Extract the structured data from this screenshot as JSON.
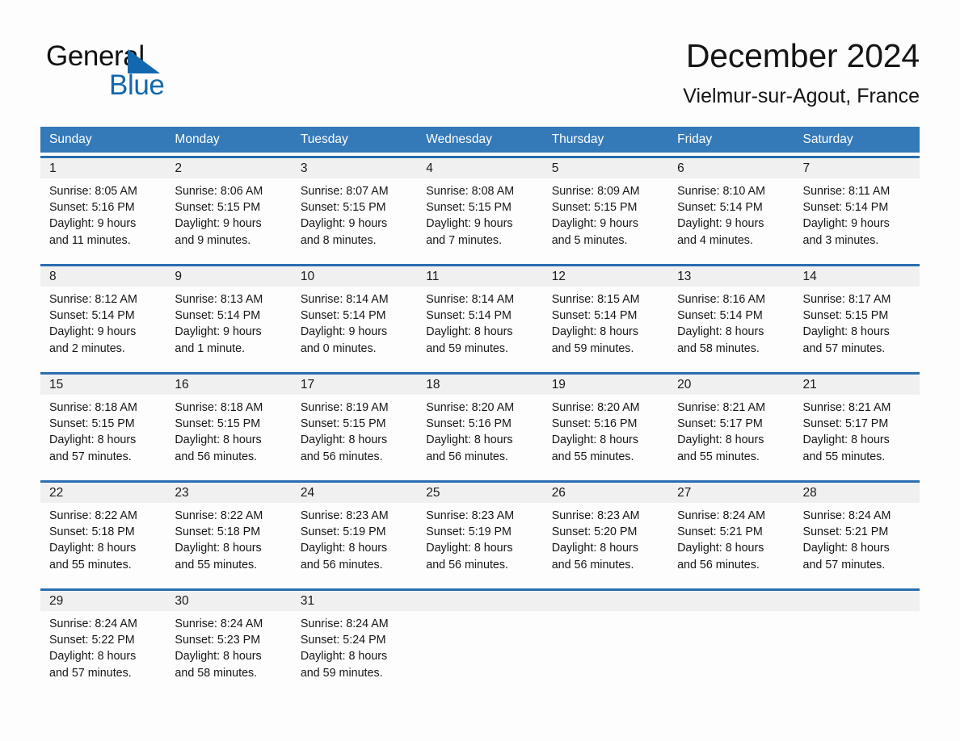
{
  "brand": {
    "word_general": "General",
    "word_blue": "Blue",
    "triangle_color": "#1368ad"
  },
  "header": {
    "title": "December 2024",
    "subtitle": "Vielmur-sur-Agout, France"
  },
  "theme": {
    "header_blue": "#3479b8",
    "rule_blue": "#2a6db0",
    "daynum_band": "#f0f0f0",
    "page_background": "#fdfdfd",
    "text": "#1a1a1a"
  },
  "weekdays": [
    "Sunday",
    "Monday",
    "Tuesday",
    "Wednesday",
    "Thursday",
    "Friday",
    "Saturday"
  ],
  "weeks": [
    {
      "days": [
        {
          "number": "1",
          "lines": [
            "Sunrise: 8:05 AM",
            "Sunset: 5:16 PM",
            "Daylight: 9 hours",
            "and 11 minutes."
          ]
        },
        {
          "number": "2",
          "lines": [
            "Sunrise: 8:06 AM",
            "Sunset: 5:15 PM",
            "Daylight: 9 hours",
            "and 9 minutes."
          ]
        },
        {
          "number": "3",
          "lines": [
            "Sunrise: 8:07 AM",
            "Sunset: 5:15 PM",
            "Daylight: 9 hours",
            "and 8 minutes."
          ]
        },
        {
          "number": "4",
          "lines": [
            "Sunrise: 8:08 AM",
            "Sunset: 5:15 PM",
            "Daylight: 9 hours",
            "and 7 minutes."
          ]
        },
        {
          "number": "5",
          "lines": [
            "Sunrise: 8:09 AM",
            "Sunset: 5:15 PM",
            "Daylight: 9 hours",
            "and 5 minutes."
          ]
        },
        {
          "number": "6",
          "lines": [
            "Sunrise: 8:10 AM",
            "Sunset: 5:14 PM",
            "Daylight: 9 hours",
            "and 4 minutes."
          ]
        },
        {
          "number": "7",
          "lines": [
            "Sunrise: 8:11 AM",
            "Sunset: 5:14 PM",
            "Daylight: 9 hours",
            "and 3 minutes."
          ]
        }
      ]
    },
    {
      "days": [
        {
          "number": "8",
          "lines": [
            "Sunrise: 8:12 AM",
            "Sunset: 5:14 PM",
            "Daylight: 9 hours",
            "and 2 minutes."
          ]
        },
        {
          "number": "9",
          "lines": [
            "Sunrise: 8:13 AM",
            "Sunset: 5:14 PM",
            "Daylight: 9 hours",
            "and 1 minute."
          ]
        },
        {
          "number": "10",
          "lines": [
            "Sunrise: 8:14 AM",
            "Sunset: 5:14 PM",
            "Daylight: 9 hours",
            "and 0 minutes."
          ]
        },
        {
          "number": "11",
          "lines": [
            "Sunrise: 8:14 AM",
            "Sunset: 5:14 PM",
            "Daylight: 8 hours",
            "and 59 minutes."
          ]
        },
        {
          "number": "12",
          "lines": [
            "Sunrise: 8:15 AM",
            "Sunset: 5:14 PM",
            "Daylight: 8 hours",
            "and 59 minutes."
          ]
        },
        {
          "number": "13",
          "lines": [
            "Sunrise: 8:16 AM",
            "Sunset: 5:14 PM",
            "Daylight: 8 hours",
            "and 58 minutes."
          ]
        },
        {
          "number": "14",
          "lines": [
            "Sunrise: 8:17 AM",
            "Sunset: 5:15 PM",
            "Daylight: 8 hours",
            "and 57 minutes."
          ]
        }
      ]
    },
    {
      "days": [
        {
          "number": "15",
          "lines": [
            "Sunrise: 8:18 AM",
            "Sunset: 5:15 PM",
            "Daylight: 8 hours",
            "and 57 minutes."
          ]
        },
        {
          "number": "16",
          "lines": [
            "Sunrise: 8:18 AM",
            "Sunset: 5:15 PM",
            "Daylight: 8 hours",
            "and 56 minutes."
          ]
        },
        {
          "number": "17",
          "lines": [
            "Sunrise: 8:19 AM",
            "Sunset: 5:15 PM",
            "Daylight: 8 hours",
            "and 56 minutes."
          ]
        },
        {
          "number": "18",
          "lines": [
            "Sunrise: 8:20 AM",
            "Sunset: 5:16 PM",
            "Daylight: 8 hours",
            "and 56 minutes."
          ]
        },
        {
          "number": "19",
          "lines": [
            "Sunrise: 8:20 AM",
            "Sunset: 5:16 PM",
            "Daylight: 8 hours",
            "and 55 minutes."
          ]
        },
        {
          "number": "20",
          "lines": [
            "Sunrise: 8:21 AM",
            "Sunset: 5:17 PM",
            "Daylight: 8 hours",
            "and 55 minutes."
          ]
        },
        {
          "number": "21",
          "lines": [
            "Sunrise: 8:21 AM",
            "Sunset: 5:17 PM",
            "Daylight: 8 hours",
            "and 55 minutes."
          ]
        }
      ]
    },
    {
      "days": [
        {
          "number": "22",
          "lines": [
            "Sunrise: 8:22 AM",
            "Sunset: 5:18 PM",
            "Daylight: 8 hours",
            "and 55 minutes."
          ]
        },
        {
          "number": "23",
          "lines": [
            "Sunrise: 8:22 AM",
            "Sunset: 5:18 PM",
            "Daylight: 8 hours",
            "and 55 minutes."
          ]
        },
        {
          "number": "24",
          "lines": [
            "Sunrise: 8:23 AM",
            "Sunset: 5:19 PM",
            "Daylight: 8 hours",
            "and 56 minutes."
          ]
        },
        {
          "number": "25",
          "lines": [
            "Sunrise: 8:23 AM",
            "Sunset: 5:19 PM",
            "Daylight: 8 hours",
            "and 56 minutes."
          ]
        },
        {
          "number": "26",
          "lines": [
            "Sunrise: 8:23 AM",
            "Sunset: 5:20 PM",
            "Daylight: 8 hours",
            "and 56 minutes."
          ]
        },
        {
          "number": "27",
          "lines": [
            "Sunrise: 8:24 AM",
            "Sunset: 5:21 PM",
            "Daylight: 8 hours",
            "and 56 minutes."
          ]
        },
        {
          "number": "28",
          "lines": [
            "Sunrise: 8:24 AM",
            "Sunset: 5:21 PM",
            "Daylight: 8 hours",
            "and 57 minutes."
          ]
        }
      ]
    },
    {
      "days": [
        {
          "number": "29",
          "lines": [
            "Sunrise: 8:24 AM",
            "Sunset: 5:22 PM",
            "Daylight: 8 hours",
            "and 57 minutes."
          ]
        },
        {
          "number": "30",
          "lines": [
            "Sunrise: 8:24 AM",
            "Sunset: 5:23 PM",
            "Daylight: 8 hours",
            "and 58 minutes."
          ]
        },
        {
          "number": "31",
          "lines": [
            "Sunrise: 8:24 AM",
            "Sunset: 5:24 PM",
            "Daylight: 8 hours",
            "and 59 minutes."
          ]
        },
        {
          "number": "",
          "lines": []
        },
        {
          "number": "",
          "lines": []
        },
        {
          "number": "",
          "lines": []
        },
        {
          "number": "",
          "lines": []
        }
      ]
    }
  ]
}
